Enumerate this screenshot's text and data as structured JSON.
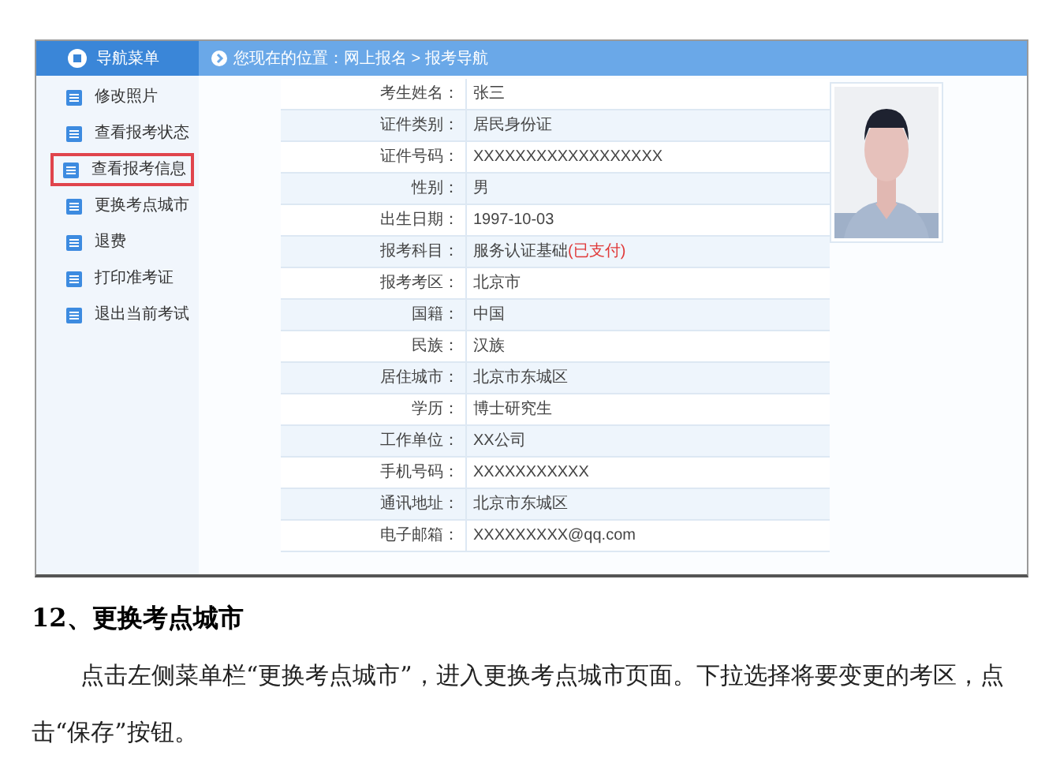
{
  "nav_header": {
    "title": "导航菜单"
  },
  "breadcrumb": "您现在的位置：网上报名 > 报考导航",
  "sidebar": {
    "items": [
      {
        "label": "修改照片",
        "highlighted": false
      },
      {
        "label": "查看报考状态",
        "highlighted": false
      },
      {
        "label": "查看报考信息",
        "highlighted": true
      },
      {
        "label": "更换考点城市",
        "highlighted": false
      },
      {
        "label": "退费",
        "highlighted": false
      },
      {
        "label": "打印准考证",
        "highlighted": false
      },
      {
        "label": "退出当前考试",
        "highlighted": false
      }
    ]
  },
  "info_table": {
    "rows": [
      {
        "label": "考生姓名：",
        "value": "张三"
      },
      {
        "label": "证件类别：",
        "value": "居民身份证"
      },
      {
        "label": "证件号码：",
        "value": "XXXXXXXXXXXXXXXXXX"
      },
      {
        "label": "性别：",
        "value": "男"
      },
      {
        "label": "出生日期：",
        "value": "1997-10-03"
      },
      {
        "label": "报考科目：",
        "value": "服务认证基础**(已支付)**"
      },
      {
        "label": "报考考区：",
        "value": "北京市"
      },
      {
        "label": "国籍：",
        "value": "中国"
      },
      {
        "label": "民族：",
        "value": "汉族"
      },
      {
        "label": "居住城市：",
        "value": "北京市东城区"
      },
      {
        "label": "学历：",
        "value": "博士研究生"
      },
      {
        "label": "工作单位：",
        "value": "XX公司"
      },
      {
        "label": "手机号码：",
        "value": "XXXXXXXXXXX"
      },
      {
        "label": "通讯地址：",
        "value": "北京市东城区"
      },
      {
        "label": "电子邮箱：",
        "value": "XXXXXXXXX@qq.com"
      }
    ]
  },
  "document": {
    "heading": "12、更换考点城市",
    "paragraph": "点击左侧菜单栏“更换考点城市”，进入更换考点城市页面。下拉选择将要变更的考区，点击“保存”按钮。"
  }
}
